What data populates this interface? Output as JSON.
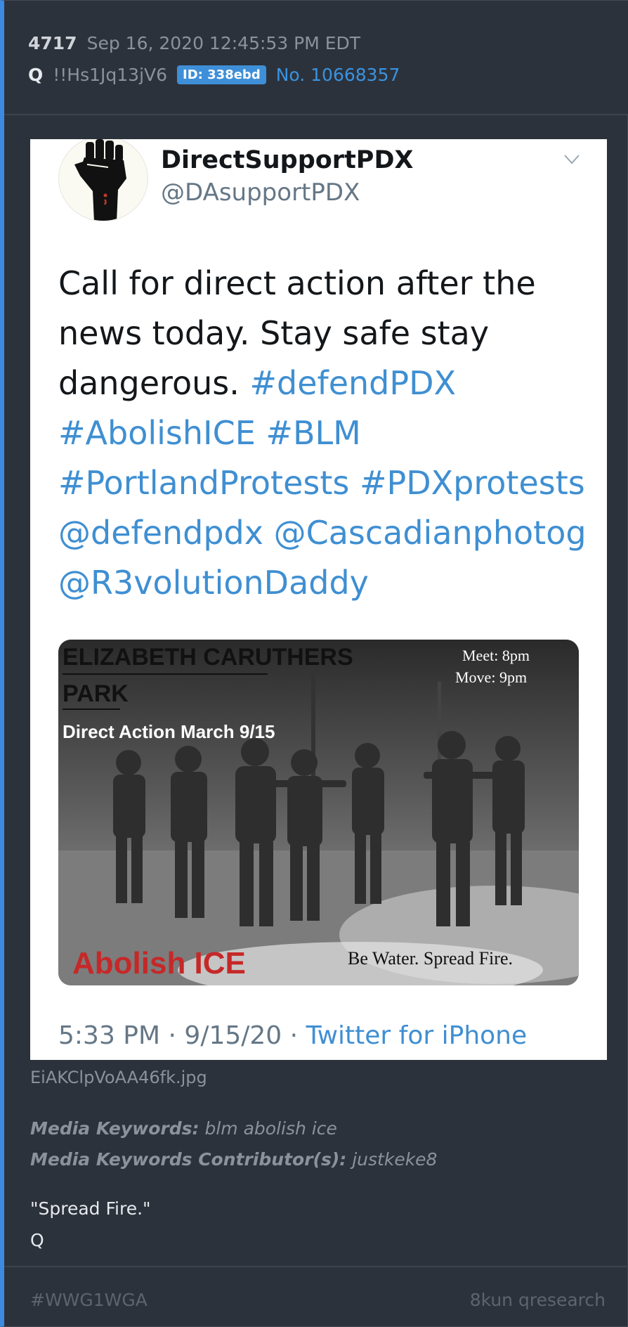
{
  "post": {
    "number": "4717",
    "date": "Sep 16, 2020 12:45:53 PM EDT",
    "author": "Q",
    "tripcode": "!!Hs1Jq13jV6",
    "id_badge": "ID: 338ebd",
    "post_no": "No. 10668357"
  },
  "tweet": {
    "display_name": "DirectSupportPDX",
    "handle": "@DAsupportPDX",
    "text_plain": "Call for direct action after the news today. Stay safe stay dangerous.",
    "links": [
      "#defendPDX",
      "#AbolishICE",
      "#BLM",
      "#PortlandProtests",
      "#PDXprotests",
      "@defendpdx",
      "@Cascadianphotog",
      "@R3volutionDaddy"
    ],
    "time": "5:33 PM",
    "date": "9/15/20",
    "source": "Twitter for iPhone",
    "media": {
      "heading_1": "ELIZABETH CARUTHERS",
      "heading_2": "PARK",
      "subheading": "Direct Action March 9/15",
      "meet": "Meet: 8pm",
      "move": "Move: 9pm",
      "bottom_left": "Abolish ICE",
      "bottom_right": "Be Water. Spread Fire."
    }
  },
  "attachment": {
    "filename": "EiAKClpVoAA46fk.jpg",
    "keywords_label": "Media Keywords:",
    "keywords": "blm abolish ice",
    "contributors_label": "Media Keywords Contributor(s):",
    "contributors": "justkeke8"
  },
  "message": {
    "line1": "\"Spread Fire.\"",
    "line2": "Q"
  },
  "footer": {
    "left": "#WWG1WGA",
    "right": "8kun qresearch"
  },
  "colors": {
    "accent": "#3d8be0",
    "link": "#3f8fd2",
    "badge": "#3e8fd8",
    "background": "#2c323c"
  }
}
